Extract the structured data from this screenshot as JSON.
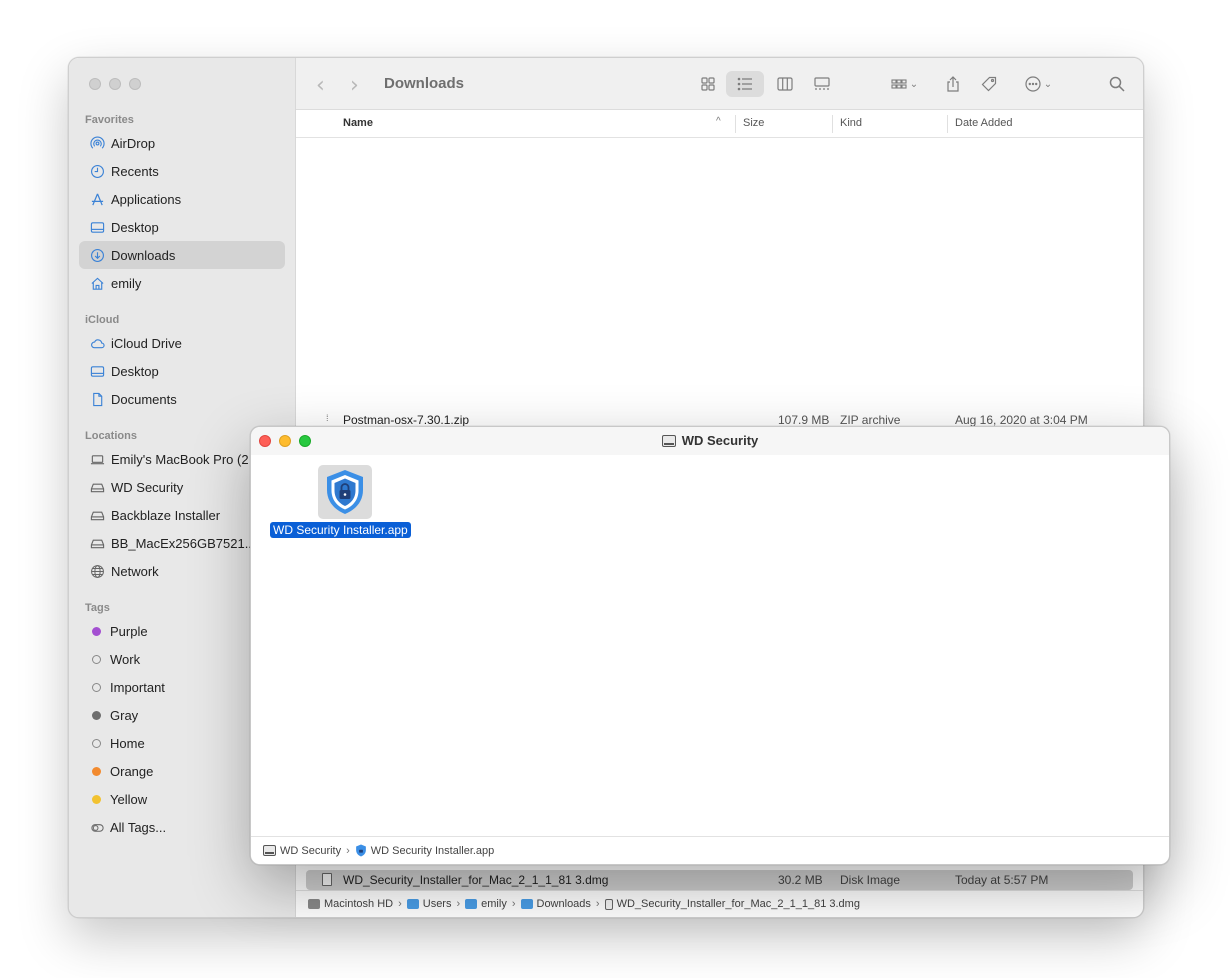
{
  "finder": {
    "title": "Downloads",
    "sidebar": {
      "favorites_label": "Favorites",
      "favorites": [
        {
          "label": "AirDrop",
          "icon": "airdrop-icon"
        },
        {
          "label": "Recents",
          "icon": "clock-icon"
        },
        {
          "label": "Applications",
          "icon": "applications-icon"
        },
        {
          "label": "Desktop",
          "icon": "desktop-icon"
        },
        {
          "label": "Downloads",
          "icon": "downloads-icon",
          "active": true
        },
        {
          "label": "emily",
          "icon": "home-icon"
        }
      ],
      "icloud_label": "iCloud",
      "icloud": [
        {
          "label": "iCloud Drive",
          "icon": "cloud-icon"
        },
        {
          "label": "Desktop",
          "icon": "desktop-icon"
        },
        {
          "label": "Documents",
          "icon": "document-icon"
        }
      ],
      "locations_label": "Locations",
      "locations": [
        {
          "label": "Emily's MacBook Pro (2",
          "icon": "laptop-icon"
        },
        {
          "label": "WD Security",
          "icon": "drive-icon"
        },
        {
          "label": "Backblaze Installer",
          "icon": "drive-icon"
        },
        {
          "label": "BB_MacEx256GB7521...",
          "icon": "drive-icon"
        },
        {
          "label": "Network",
          "icon": "globe-icon"
        }
      ],
      "tags_label": "Tags",
      "tags": [
        {
          "label": "Purple",
          "color": "#a34fd1"
        },
        {
          "label": "Work",
          "color": ""
        },
        {
          "label": "Important",
          "color": ""
        },
        {
          "label": "Gray",
          "color": "#6e6e6e"
        },
        {
          "label": "Home",
          "color": ""
        },
        {
          "label": "Orange",
          "color": "#f28a2e"
        },
        {
          "label": "Yellow",
          "color": "#f2c230"
        },
        {
          "label": "All Tags...",
          "color": "all"
        }
      ]
    },
    "columns": {
      "name": "Name",
      "size": "Size",
      "kind": "Kind",
      "date_added": "Date Added"
    },
    "rows": [
      {
        "name": "Postman-osx-7.30.1.zip",
        "size": "107.9 MB",
        "kind": "ZIP archive",
        "date": "Aug 16, 2020 at 3:04 PM"
      },
      {
        "name": "WD_Security_Installer_for_Mac_2_1_1_81 3.dmg",
        "size": "30.2 MB",
        "kind": "Disk Image",
        "date": "Today at 5:57 PM"
      }
    ],
    "path": [
      "Macintosh HD",
      "Users",
      "emily",
      "Downloads",
      "WD_Security_Installer_for_Mac_2_1_1_81 3.dmg"
    ]
  },
  "wd_window": {
    "title": "WD Security",
    "app_name": "WD Security Installer.app",
    "path": [
      "WD Security",
      "WD Security Installer.app"
    ]
  },
  "colors": {
    "selection_blue": "#0a5fd6",
    "accent_blue": "#3b82d6"
  }
}
